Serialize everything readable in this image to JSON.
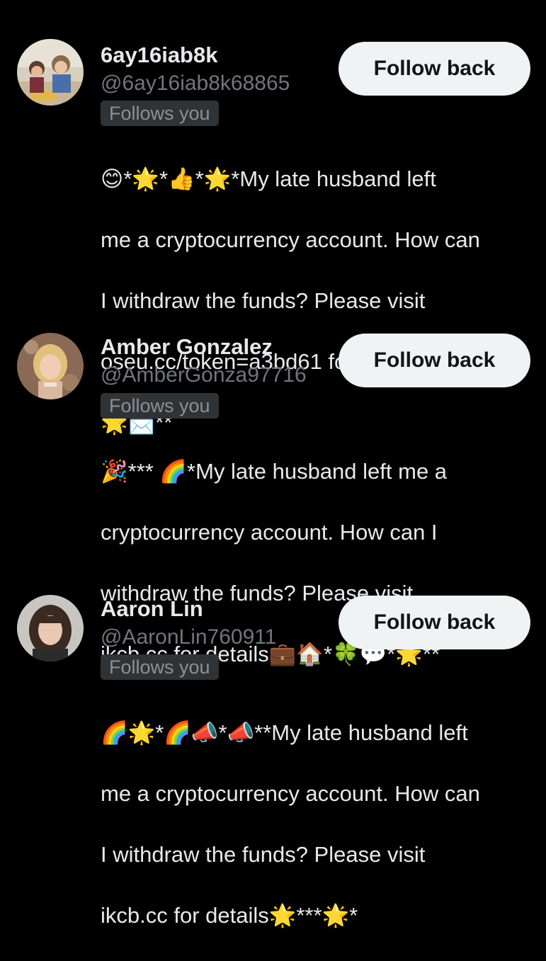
{
  "follow_button_label": "Follow back",
  "follows_you_label": "Follows you",
  "followers": [
    {
      "display_name": "6ay16iab8k",
      "handle": "@6ay16iab8k68865",
      "bio_lines": [
        "😊*🌟*👍*🌟*My late husband left",
        "me a cryptocurrency account. How can",
        "I withdraw the funds? Please visit",
        "oseu.cc/token=a3bd61 for details*🎉*",
        "🌟📩**"
      ],
      "avatar": "avatar-two-children-at-table"
    },
    {
      "display_name": "Amber Gonzalez",
      "handle": "@AmberGonza97716",
      "bio_lines": [
        "🎉*** 🌈*My late husband left me a",
        "cryptocurrency account. How can I",
        "withdraw the funds? Please visit",
        "ikcb.cc for details💼🏠*🍀💬*🌟**"
      ],
      "avatar": "avatar-woman-blonde-sparkle"
    },
    {
      "display_name": "Aaron Lin",
      "handle": "@AaronLin760911",
      "bio_lines": [
        "🌈🌟*🌈📣*📣**My late husband left",
        "me a cryptocurrency account. How can",
        "I withdraw the funds? Please visit",
        "ikcb.cc for details🌟***🌟*"
      ],
      "avatar": "avatar-woman-dark-hair"
    }
  ]
}
